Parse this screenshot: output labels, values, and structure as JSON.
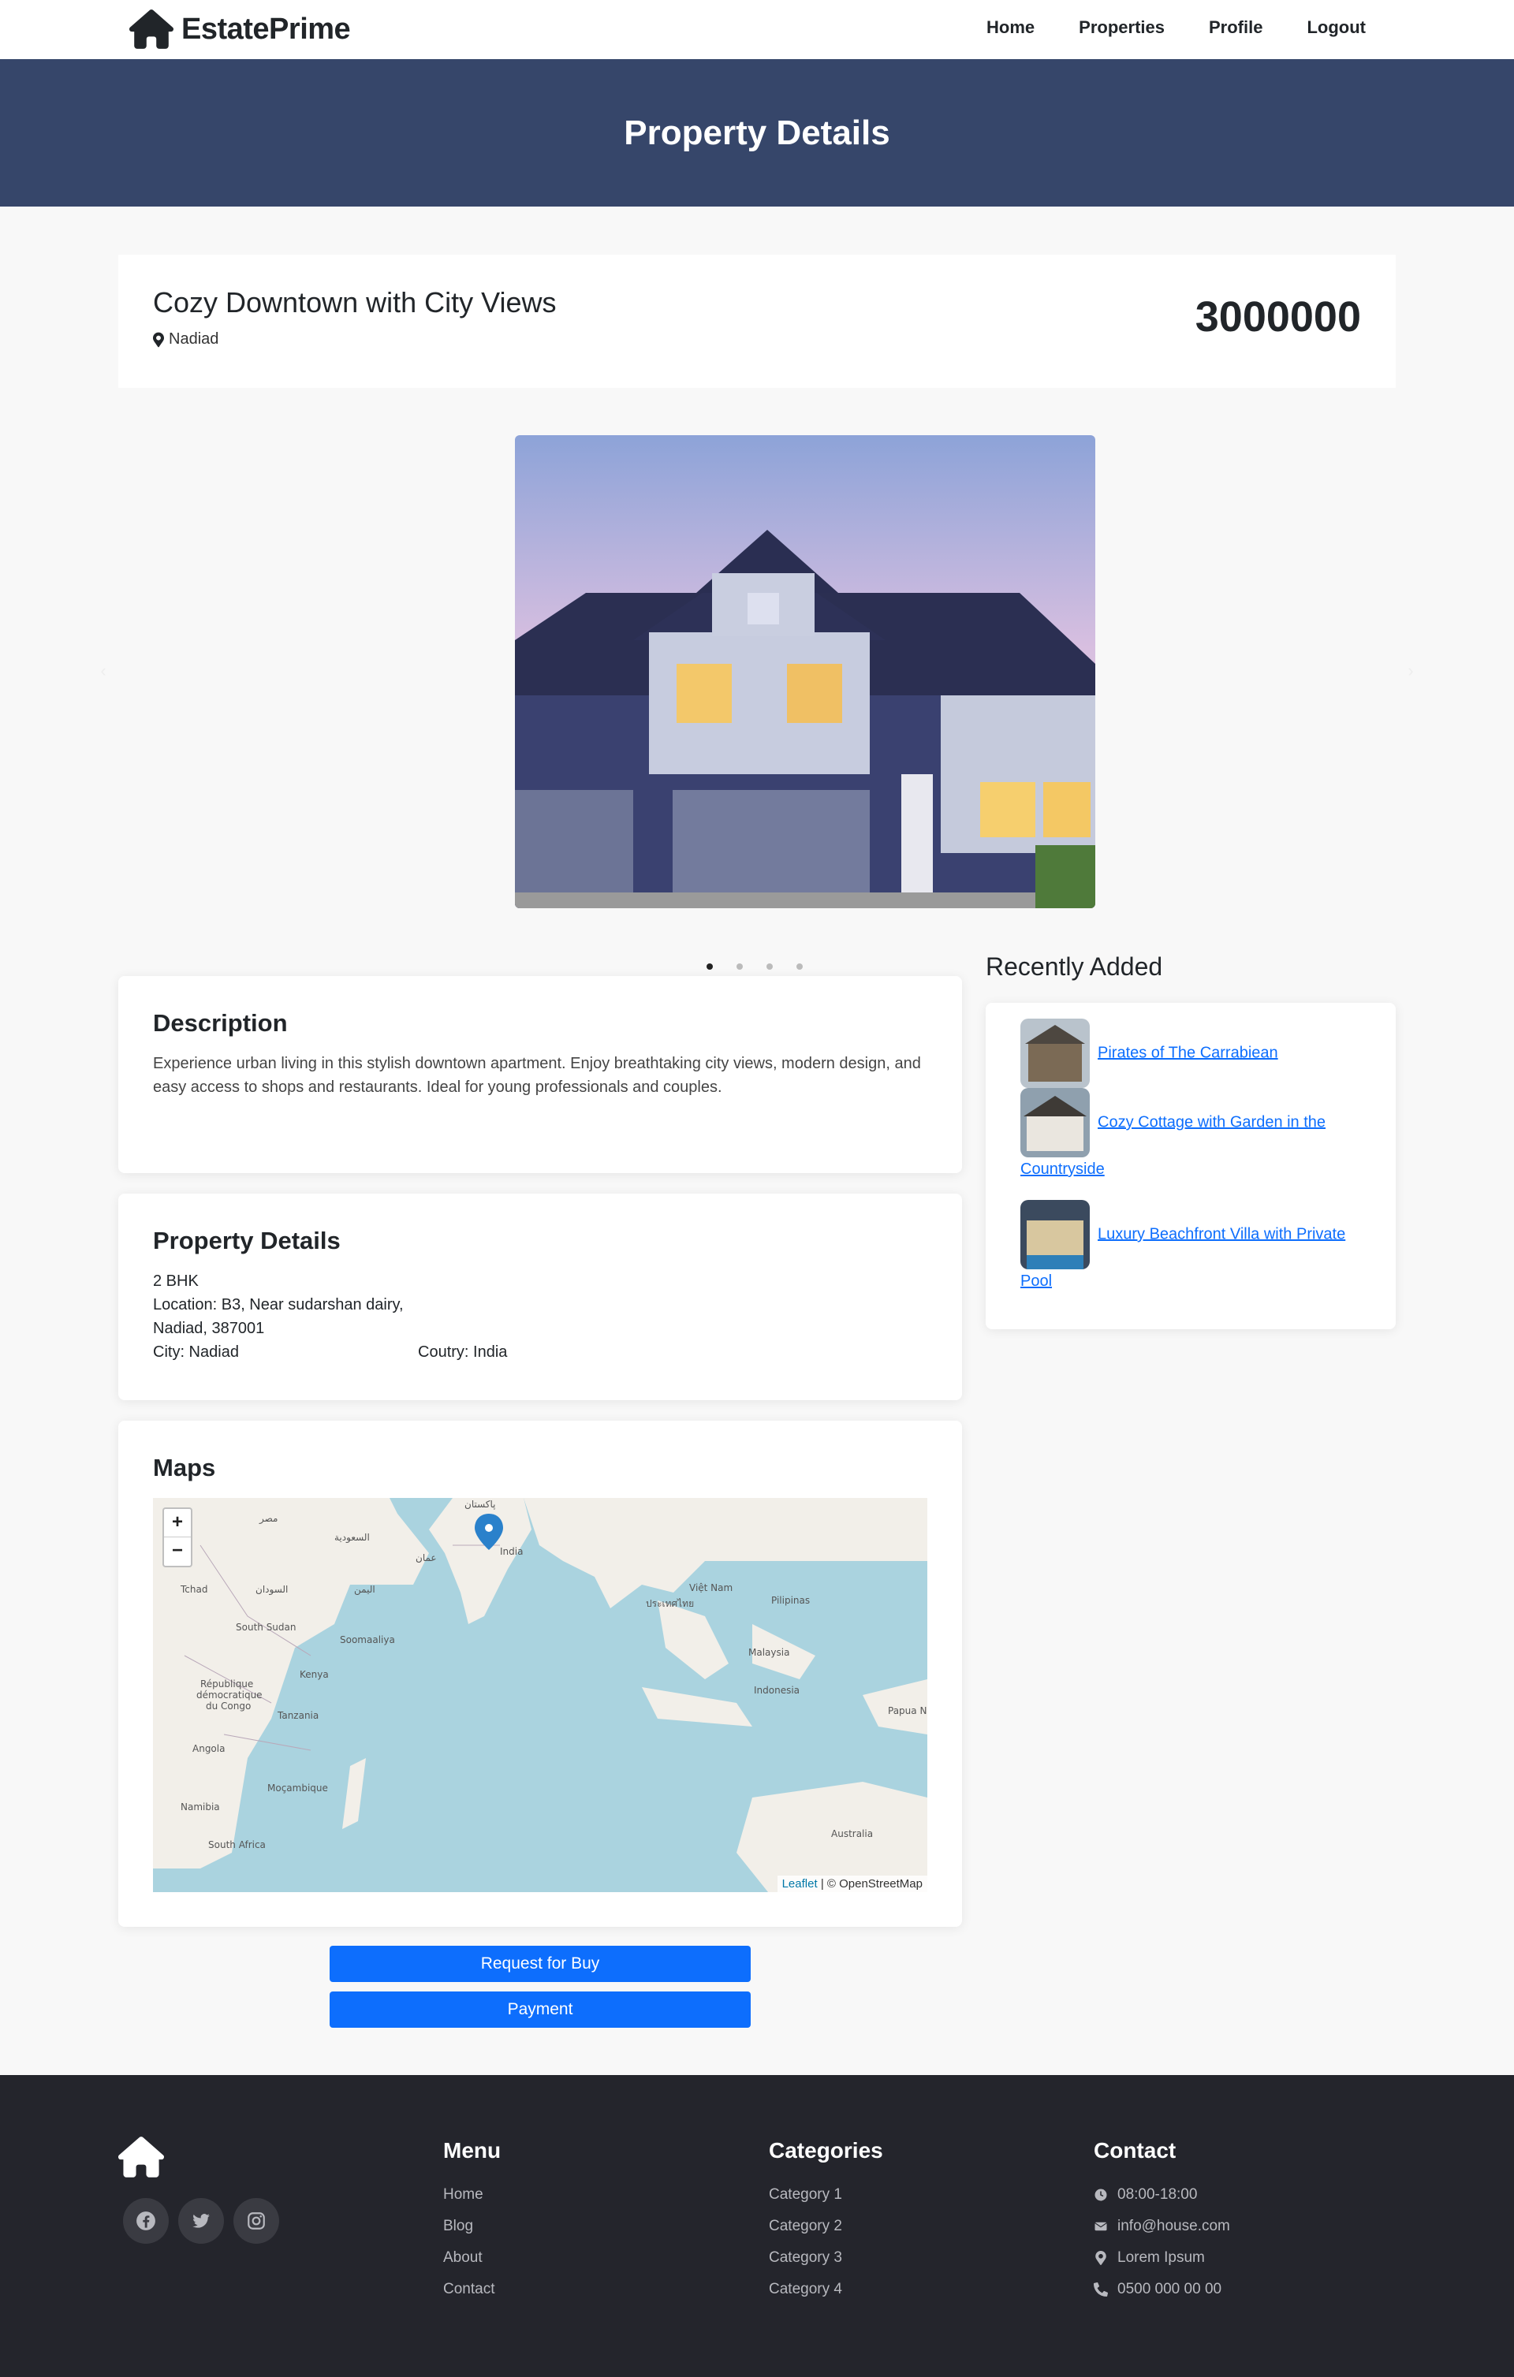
{
  "navbar": {
    "brand": "EstatePrime",
    "links": [
      "Home",
      "Properties",
      "Profile",
      "Logout"
    ]
  },
  "hero": {
    "title": "Property Details"
  },
  "property": {
    "title": "Cozy Downtown with City Views",
    "location": "Nadiad",
    "price": "3000000"
  },
  "carousel": {
    "slides": 4,
    "active_index": 0
  },
  "description": {
    "heading": "Description",
    "text": "Experience urban living in this stylish downtown apartment. Enjoy breathtaking city views, modern design, and easy access to shops and restaurants. Ideal for young professionals and couples."
  },
  "details": {
    "heading": "Property Details",
    "bhk": "2 BHK",
    "location": "Location: B3, Near sudarshan dairy, Nadiad, 387001",
    "city": "City: Nadiad",
    "country": "Coutry: India"
  },
  "maps": {
    "heading": "Maps",
    "zoom_in": "+",
    "zoom_out": "−",
    "attribution_leaflet": "Leaflet",
    "attribution_osm": "| © OpenStreetMap",
    "labels": [
      "پاکستان",
      "India",
      "السعودية",
      "مصر",
      "Tchad",
      "السودان",
      "اليمن",
      "عمان",
      "Việt Nam",
      "Pilipinas",
      "Malaysia",
      "Indonesia",
      "Soomaaliya",
      "Kenya",
      "Tanzania",
      "République démocratique du Congo",
      "Angola",
      "Moçambique",
      "Namibia",
      "South Africa",
      "Australia",
      "Papua N",
      "South Sudan",
      "ประเทศไทย"
    ]
  },
  "buttons": {
    "request": "Request for Buy",
    "payment": "Payment"
  },
  "recent": {
    "heading": "Recently Added",
    "items": [
      "Pirates of The Carrabiean",
      "Cozy Cottage with Garden in the Countryside",
      "Luxury Beachfront Villa with Private Pool"
    ]
  },
  "footer": {
    "menu_heading": "Menu",
    "menu": [
      "Home",
      "Blog",
      "About",
      "Contact"
    ],
    "categories_heading": "Categories",
    "categories": [
      "Category 1",
      "Category 2",
      "Category 3",
      "Category 4"
    ],
    "contact_heading": "Contact",
    "contact": {
      "hours": "08:00-18:00",
      "email": "info@house.com",
      "address": "Lorem Ipsum",
      "phone": "0500 000 00 00"
    },
    "social_icons": [
      "facebook-icon",
      "twitter-icon",
      "instagram-icon"
    ]
  },
  "colors": {
    "hero_bg": "#36466a",
    "primary": "#0d6efd",
    "footer_bg": "#24252c"
  }
}
